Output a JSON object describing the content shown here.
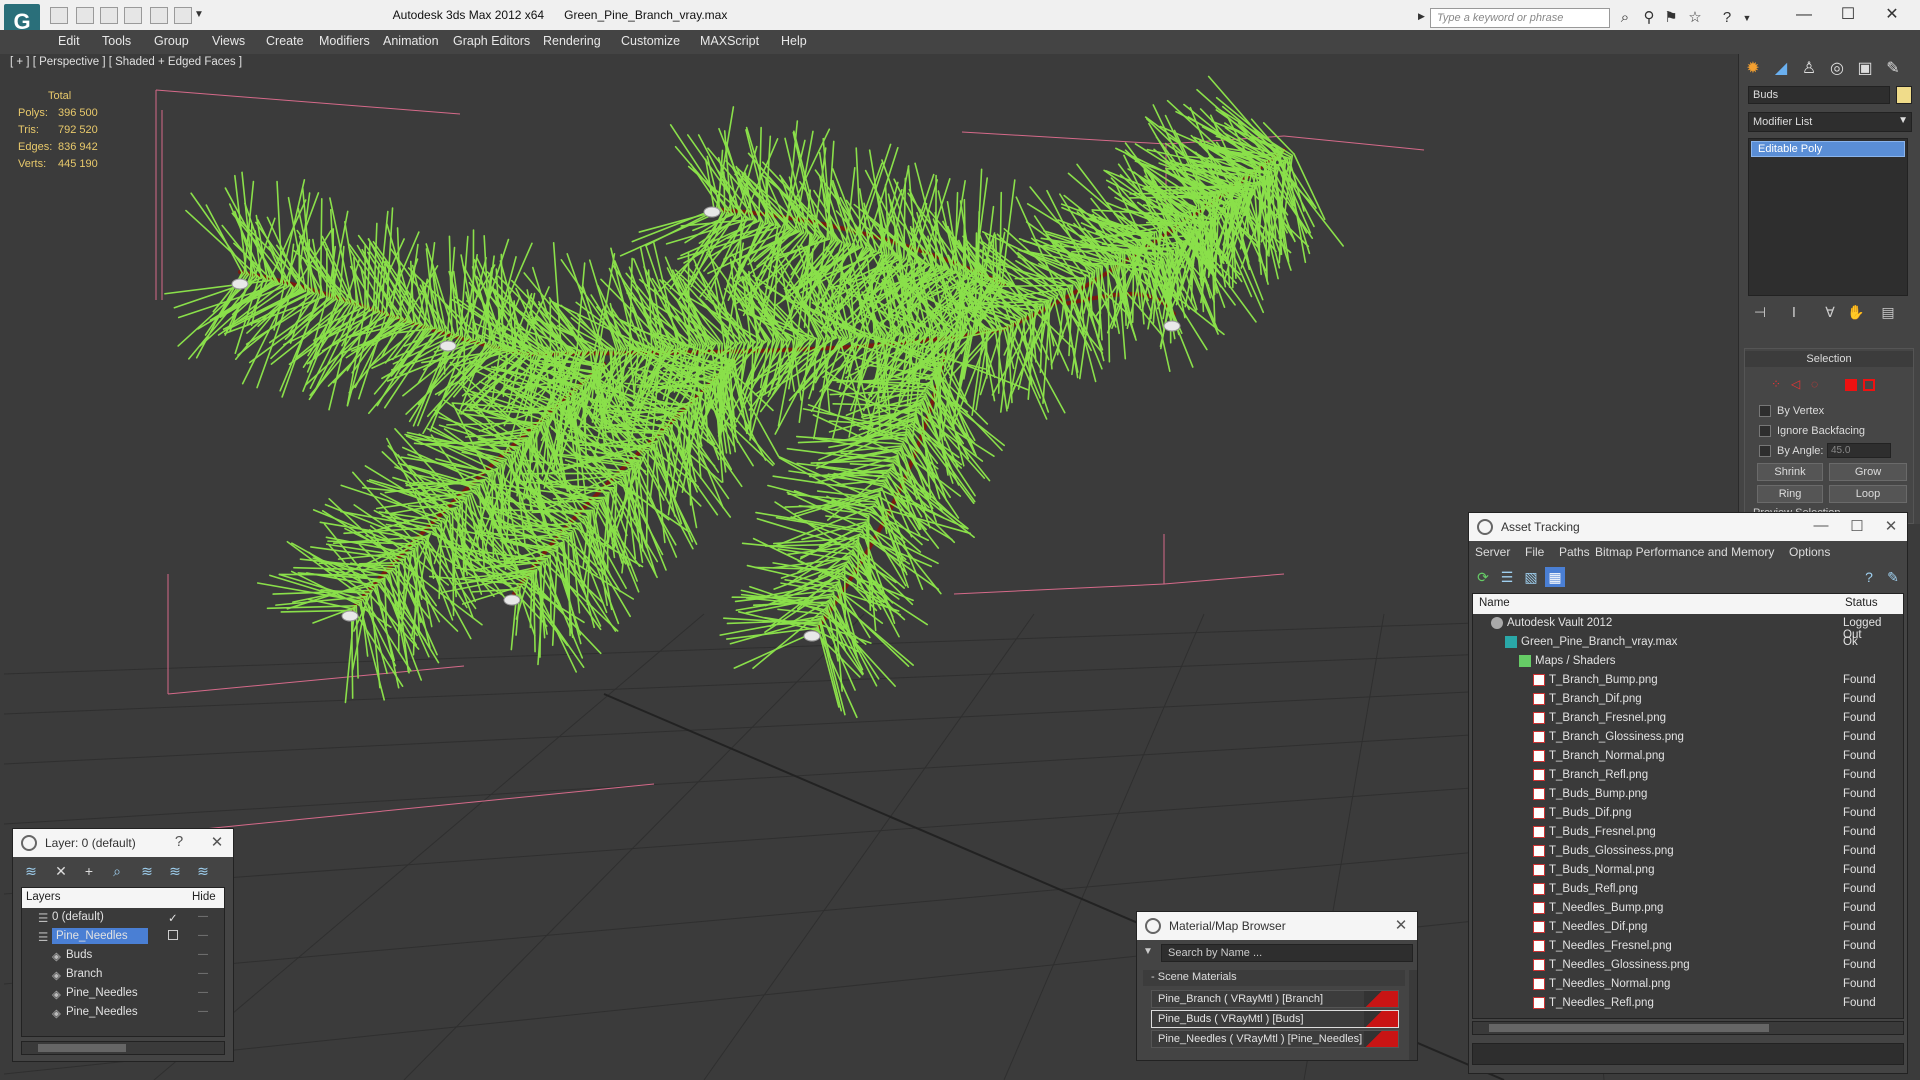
{
  "titlebar": {
    "app_title": "Autodesk 3ds Max  2012 x64",
    "file_title": "Green_Pine_Branch_vray.max",
    "search_placeholder": "Type a keyword or phrase"
  },
  "menu": [
    "Edit",
    "Tools",
    "Group",
    "Views",
    "Create",
    "Modifiers",
    "Animation",
    "Graph Editors",
    "Rendering",
    "Customize",
    "MAXScript",
    "Help"
  ],
  "viewport": {
    "label": "[ + ] [ Perspective ] [ Shaded + Edged Faces ]",
    "stats": {
      "header": "Total",
      "rows": [
        {
          "label": "Polys:",
          "value": "396 500"
        },
        {
          "label": "Tris:",
          "value": "792 520"
        },
        {
          "label": "Edges:",
          "value": "836 942"
        },
        {
          "label": "Verts:",
          "value": "445 190"
        }
      ]
    }
  },
  "command_panel": {
    "object_name": "Buds",
    "modifier_list": "Modifier List",
    "stack_item": "Editable Poly",
    "selection": {
      "title": "Selection",
      "by_vertex": "By Vertex",
      "ignore_backfacing": "Ignore Backfacing",
      "by_angle": "By Angle:",
      "angle_value": "45.0",
      "shrink": "Shrink",
      "grow": "Grow",
      "ring": "Ring",
      "loop": "Loop",
      "preview": "Preview Selection"
    }
  },
  "asset_tracking": {
    "title": "Asset Tracking",
    "menu": [
      "Server",
      "File",
      "Paths",
      "Bitmap Performance and Memory",
      "Options"
    ],
    "columns": {
      "name": "Name",
      "status": "Status"
    },
    "rows": [
      {
        "name": "Autodesk Vault 2012",
        "status": "Logged Out",
        "type": "vault",
        "indent": 0
      },
      {
        "name": "Green_Pine_Branch_vray.max",
        "status": "Ok",
        "type": "max",
        "indent": 1
      },
      {
        "name": "Maps / Shaders",
        "status": "",
        "type": "folder",
        "indent": 2
      },
      {
        "name": "T_Branch_Bump.png",
        "status": "Found",
        "type": "png",
        "indent": 3
      },
      {
        "name": "T_Branch_Dif.png",
        "status": "Found",
        "type": "png",
        "indent": 3
      },
      {
        "name": "T_Branch_Fresnel.png",
        "status": "Found",
        "type": "png",
        "indent": 3
      },
      {
        "name": "T_Branch_Glossiness.png",
        "status": "Found",
        "type": "png",
        "indent": 3
      },
      {
        "name": "T_Branch_Normal.png",
        "status": "Found",
        "type": "png",
        "indent": 3
      },
      {
        "name": "T_Branch_Refl.png",
        "status": "Found",
        "type": "png",
        "indent": 3
      },
      {
        "name": "T_Buds_Bump.png",
        "status": "Found",
        "type": "png",
        "indent": 3
      },
      {
        "name": "T_Buds_Dif.png",
        "status": "Found",
        "type": "png",
        "indent": 3
      },
      {
        "name": "T_Buds_Fresnel.png",
        "status": "Found",
        "type": "png",
        "indent": 3
      },
      {
        "name": "T_Buds_Glossiness.png",
        "status": "Found",
        "type": "png",
        "indent": 3
      },
      {
        "name": "T_Buds_Normal.png",
        "status": "Found",
        "type": "png",
        "indent": 3
      },
      {
        "name": "T_Buds_Refl.png",
        "status": "Found",
        "type": "png",
        "indent": 3
      },
      {
        "name": "T_Needles_Bump.png",
        "status": "Found",
        "type": "png",
        "indent": 3
      },
      {
        "name": "T_Needles_Dif.png",
        "status": "Found",
        "type": "png",
        "indent": 3
      },
      {
        "name": "T_Needles_Fresnel.png",
        "status": "Found",
        "type": "png",
        "indent": 3
      },
      {
        "name": "T_Needles_Glossiness.png",
        "status": "Found",
        "type": "png",
        "indent": 3
      },
      {
        "name": "T_Needles_Normal.png",
        "status": "Found",
        "type": "png",
        "indent": 3
      },
      {
        "name": "T_Needles_Refl.png",
        "status": "Found",
        "type": "png",
        "indent": 3
      }
    ]
  },
  "layer_window": {
    "title": "Layer: 0 (default)",
    "help": "?",
    "columns": {
      "layers": "Layers",
      "hide": "Hide"
    },
    "rows": [
      {
        "name": "0 (default)",
        "indent": 0,
        "selected": false
      },
      {
        "name": "Pine_Needles",
        "indent": 0,
        "selected": true
      },
      {
        "name": "Buds",
        "indent": 1,
        "selected": false
      },
      {
        "name": "Branch",
        "indent": 1,
        "selected": false
      },
      {
        "name": "Pine_Needles",
        "indent": 1,
        "selected": false
      },
      {
        "name": "Pine_Needles",
        "indent": 1,
        "selected": false
      }
    ]
  },
  "material_browser": {
    "title": "Material/Map Browser",
    "search_placeholder": "Search by Name ...",
    "section": "Scene Materials",
    "items": [
      "Pine_Branch  ( VRayMtl )  [Branch]",
      "Pine_Buds  ( VRayMtl )  [Buds]",
      "Pine_Needles  ( VRayMtl )  [Pine_Needles]"
    ]
  },
  "colors": {
    "needles": "#8ae04a",
    "branch": "#7a1a10",
    "viewport_bg": "#3b3b3b",
    "selection_blue": "#4a7fd4"
  }
}
